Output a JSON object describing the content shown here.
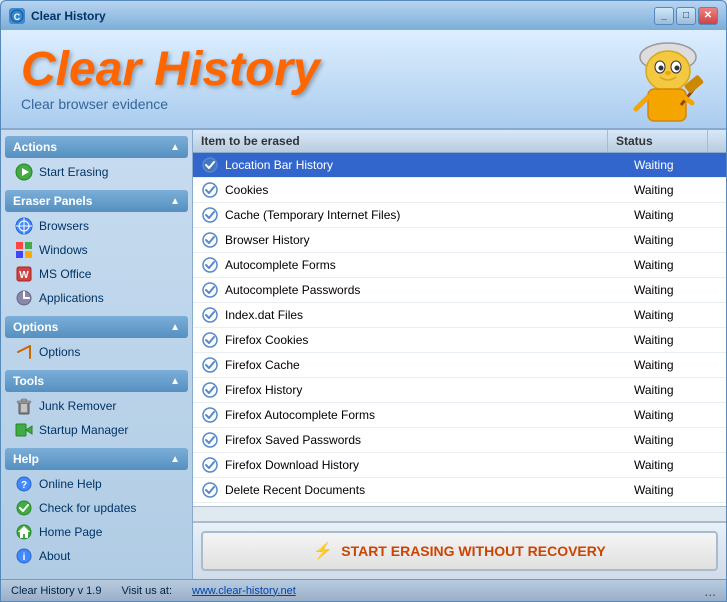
{
  "titlebar": {
    "title": "Clear History",
    "icon": "CH"
  },
  "header": {
    "logo_title": "Clear History",
    "logo_subtitle": "Clear browser evidence"
  },
  "sidebar": {
    "sections": [
      {
        "id": "actions",
        "label": "Actions",
        "items": [
          {
            "id": "start-erasing",
            "label": "Start Erasing",
            "icon": "⚡"
          }
        ]
      },
      {
        "id": "eraser-panels",
        "label": "Eraser Panels",
        "items": [
          {
            "id": "browsers",
            "label": "Browsers",
            "icon": "🌐"
          },
          {
            "id": "windows",
            "label": "Windows",
            "icon": "🖥"
          },
          {
            "id": "ms-office",
            "label": "MS Office",
            "icon": "📋"
          },
          {
            "id": "applications",
            "label": "Applications",
            "icon": "⚙"
          }
        ]
      },
      {
        "id": "options",
        "label": "Options",
        "items": [
          {
            "id": "options",
            "label": "Options",
            "icon": "🔧"
          }
        ]
      },
      {
        "id": "tools",
        "label": "Tools",
        "items": [
          {
            "id": "junk-remover",
            "label": "Junk Remover",
            "icon": "🗑"
          },
          {
            "id": "startup-manager",
            "label": "Startup Manager",
            "icon": "🚀"
          }
        ]
      },
      {
        "id": "help",
        "label": "Help",
        "items": [
          {
            "id": "online-help",
            "label": "Online Help",
            "icon": "❓"
          },
          {
            "id": "check-updates",
            "label": "Check for updates",
            "icon": "🔄"
          },
          {
            "id": "home-page",
            "label": "Home Page",
            "icon": "🏠"
          },
          {
            "id": "about",
            "label": "About",
            "icon": "ℹ"
          }
        ]
      }
    ]
  },
  "table": {
    "col_item": "Item to be erased",
    "col_status": "Status",
    "rows": [
      {
        "id": 1,
        "name": "Location Bar History",
        "status": "Waiting",
        "selected": true
      },
      {
        "id": 2,
        "name": "Cookies",
        "status": "Waiting",
        "selected": false
      },
      {
        "id": 3,
        "name": "Cache (Temporary Internet Files)",
        "status": "Waiting",
        "selected": false
      },
      {
        "id": 4,
        "name": "Browser History",
        "status": "Waiting",
        "selected": false
      },
      {
        "id": 5,
        "name": "Autocomplete Forms",
        "status": "Waiting",
        "selected": false
      },
      {
        "id": 6,
        "name": "Autocomplete Passwords",
        "status": "Waiting",
        "selected": false
      },
      {
        "id": 7,
        "name": "Index.dat Files",
        "status": "Waiting",
        "selected": false
      },
      {
        "id": 8,
        "name": "Firefox Cookies",
        "status": "Waiting",
        "selected": false
      },
      {
        "id": 9,
        "name": "Firefox Cache",
        "status": "Waiting",
        "selected": false
      },
      {
        "id": 10,
        "name": "Firefox History",
        "status": "Waiting",
        "selected": false
      },
      {
        "id": 11,
        "name": "Firefox Autocomplete Forms",
        "status": "Waiting",
        "selected": false
      },
      {
        "id": 12,
        "name": "Firefox Saved Passwords",
        "status": "Waiting",
        "selected": false
      },
      {
        "id": 13,
        "name": "Firefox Download History",
        "status": "Waiting",
        "selected": false
      },
      {
        "id": 14,
        "name": "Delete Recent Documents",
        "status": "Waiting",
        "selected": false
      }
    ]
  },
  "action_button": {
    "label": "START ERASING WITHOUT RECOVERY",
    "icon": "⚡"
  },
  "statusbar": {
    "left": "Clear History v 1.9",
    "middle_label": "Visit us at:",
    "middle_link": "www.clear-history.net",
    "dots": "..."
  }
}
